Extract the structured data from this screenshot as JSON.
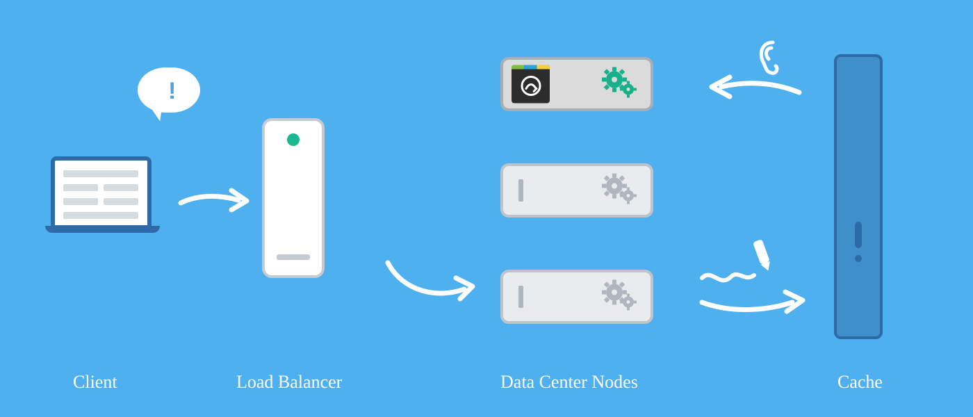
{
  "labels": {
    "client": "Client",
    "load_balancer": "Load Balancer",
    "data_center_nodes": "Data Center Nodes",
    "cache": "Cache"
  },
  "client": {
    "speech_mark": "!"
  },
  "cache": {
    "mark": "!"
  },
  "nodes": [
    {
      "kind": "active",
      "gear_color": "#18b08a"
    },
    {
      "kind": "idle",
      "gear_color": "#b0b6bd"
    },
    {
      "kind": "idle",
      "gear_color": "#b0b6bd"
    }
  ],
  "connections": [
    {
      "from": "client",
      "to": "load_balancer",
      "style": "arrow"
    },
    {
      "from": "load_balancer",
      "to": "nodes",
      "style": "arrow"
    },
    {
      "from": "nodes",
      "to": "cache",
      "style": "arrow",
      "decor": "pencil-write"
    },
    {
      "from": "cache",
      "to": "nodes",
      "style": "arrow",
      "decor": "ear-listen"
    }
  ],
  "colors": {
    "background": "#4eb0ee",
    "server_border": "#bfc4cb",
    "server_fill": "#e9ecef",
    "accent_green": "#1bb790",
    "cache_fill": "#3e8fca",
    "cache_border": "#2f6aa8",
    "ink": "#ffffff"
  }
}
